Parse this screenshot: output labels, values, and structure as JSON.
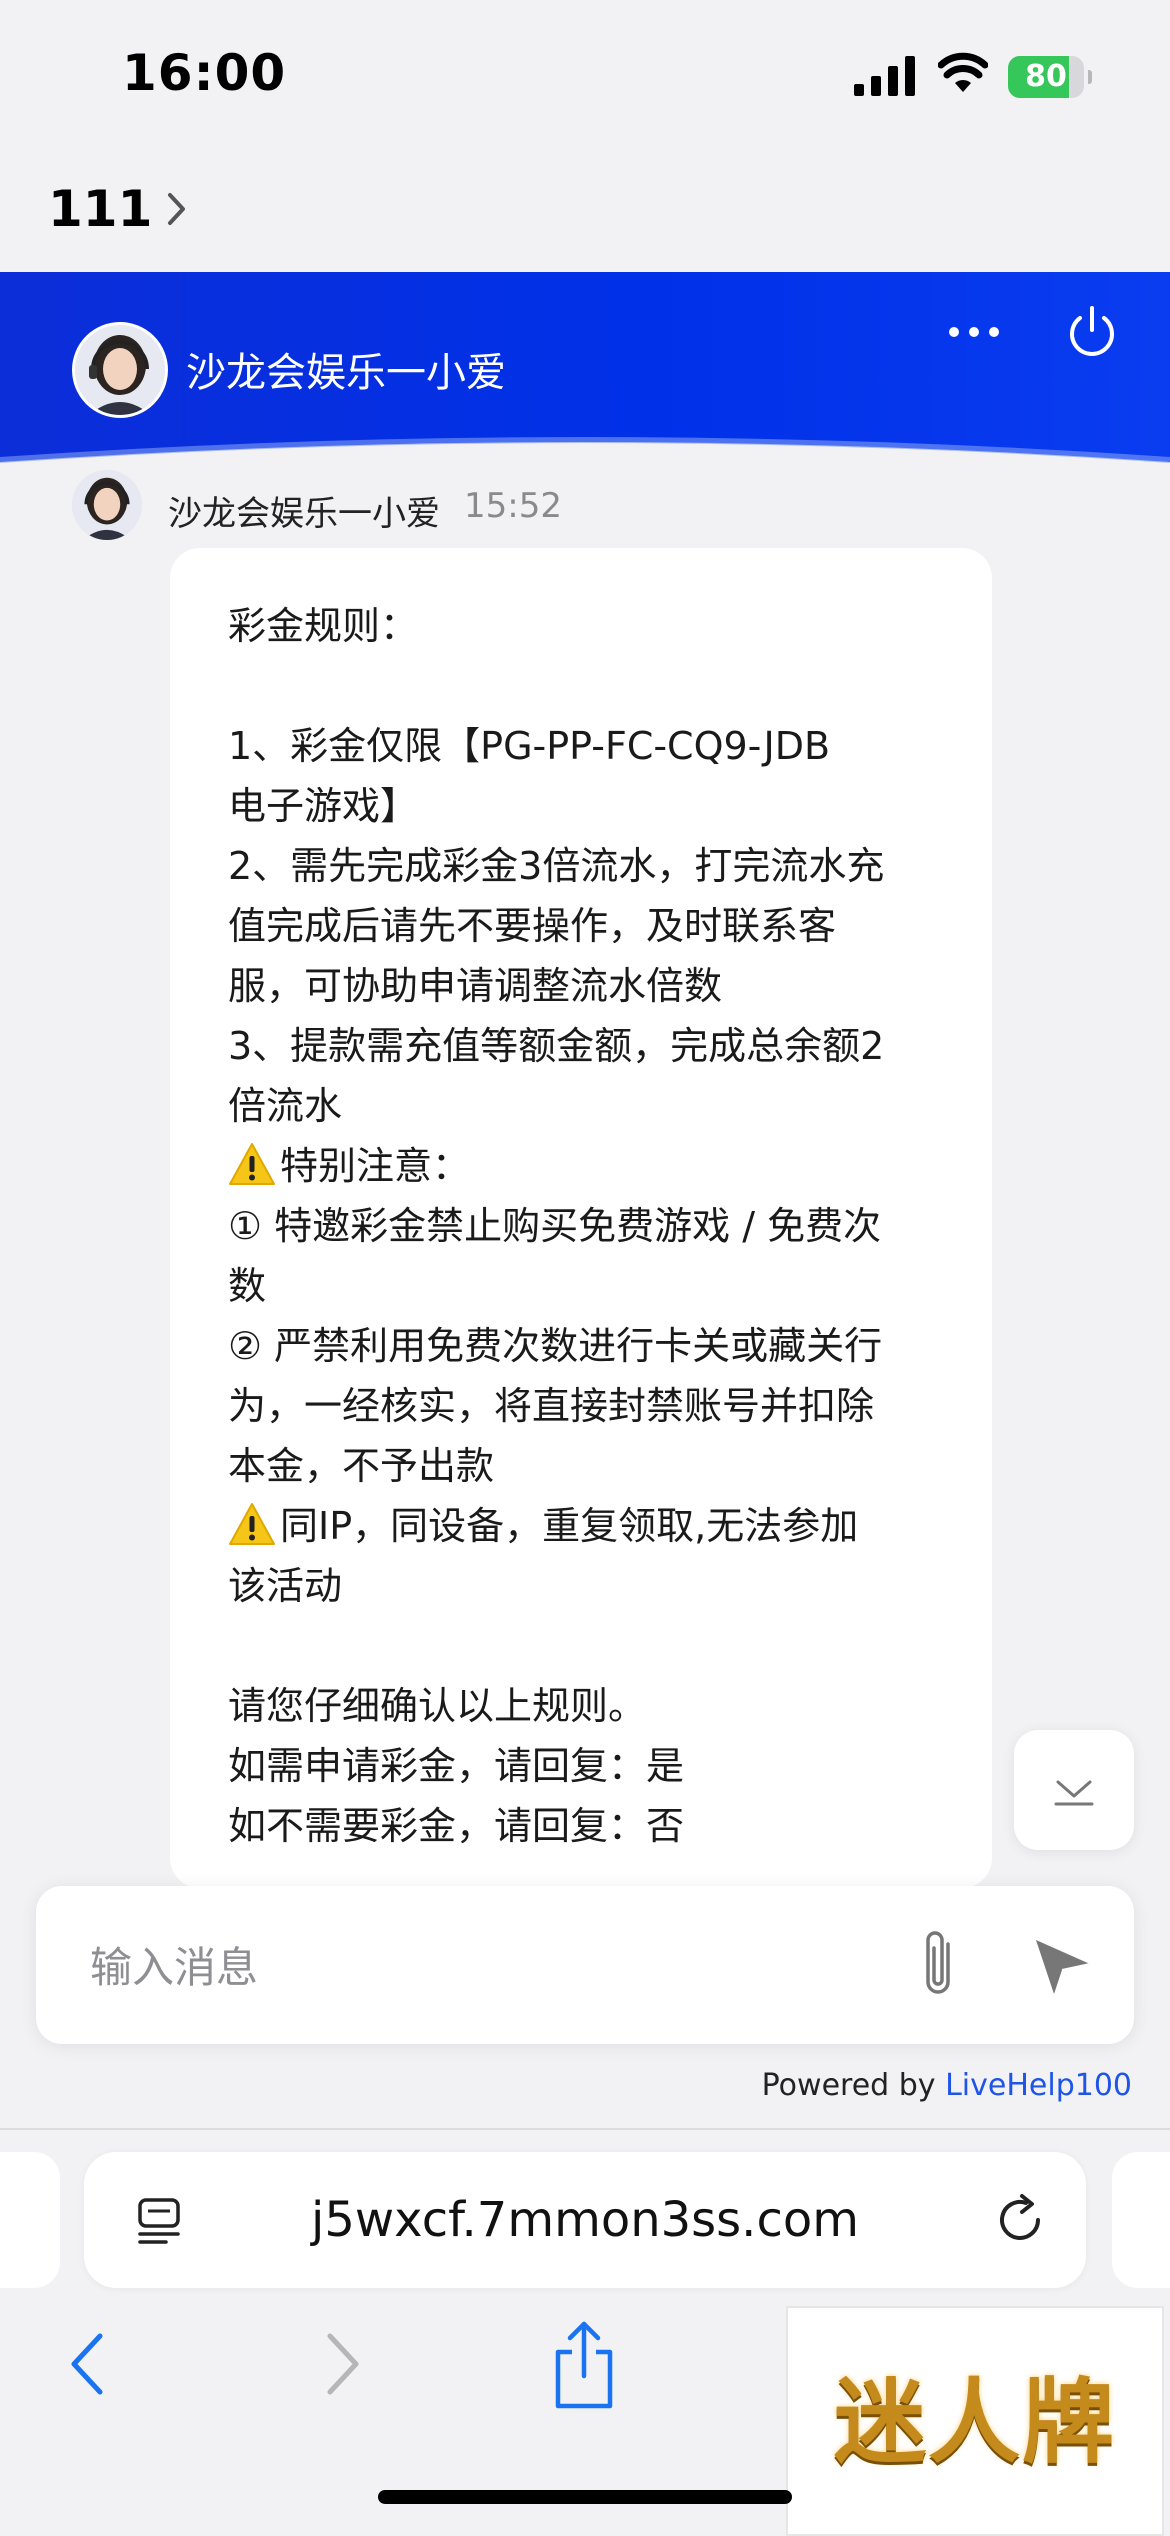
{
  "status_bar": {
    "time": "16:00",
    "battery": "80",
    "battery_level": 0.8
  },
  "nav": {
    "back_label": "111"
  },
  "chat_header": {
    "agent_name": "沙龙会娱乐一小爱"
  },
  "message": {
    "sender": "沙龙会娱乐一小爱",
    "time": "15:52",
    "lines": [
      "彩金规则：",
      "",
      "1、彩金仅限【PG-PP-FC-CQ9-JDB",
      "电子游戏】",
      "2、需先完成彩金3倍流水，打完流水充",
      "值完成后请先不要操作，及时联系客",
      "服，可协助申请调整流水倍数",
      "3、提款需充值等额金额，完成总余额2",
      "倍流水",
      "特别注意：",
      "① 特邀彩金禁止购买免费游戏 / 免费次",
      "数",
      "② 严禁利用免费次数进行卡关或藏关行",
      "为，一经核实，将直接封禁账号并扣除",
      "本金，不予出款",
      "同IP，同设备，重复领取,无法参加",
      "该活动",
      "",
      "请您仔细确认以上规则。",
      "如需申请彩金，请回复：是",
      "如不需要彩金，请回复：否"
    ]
  },
  "composer": {
    "placeholder": "输入消息"
  },
  "footer": {
    "powered_prefix": "Powered by ",
    "powered_link": "LiveHelp100"
  },
  "browser": {
    "url": "j5wxcf.7mmon3ss.com"
  },
  "watermark": {
    "text": "迷人牌"
  },
  "colors": {
    "header_blue": "#0030e8",
    "link_blue": "#1f55e6",
    "battery_green": "#35c759",
    "ios_blue": "#1a73f0"
  },
  "icons": [
    "signal-icon",
    "wifi-icon",
    "battery-icon",
    "chevron-right-icon",
    "more-icon",
    "power-icon",
    "warning-icon",
    "chevron-down-icon",
    "paperclip-icon",
    "send-icon",
    "reader-icon",
    "reload-icon",
    "back-icon",
    "forward-icon",
    "share-icon"
  ]
}
